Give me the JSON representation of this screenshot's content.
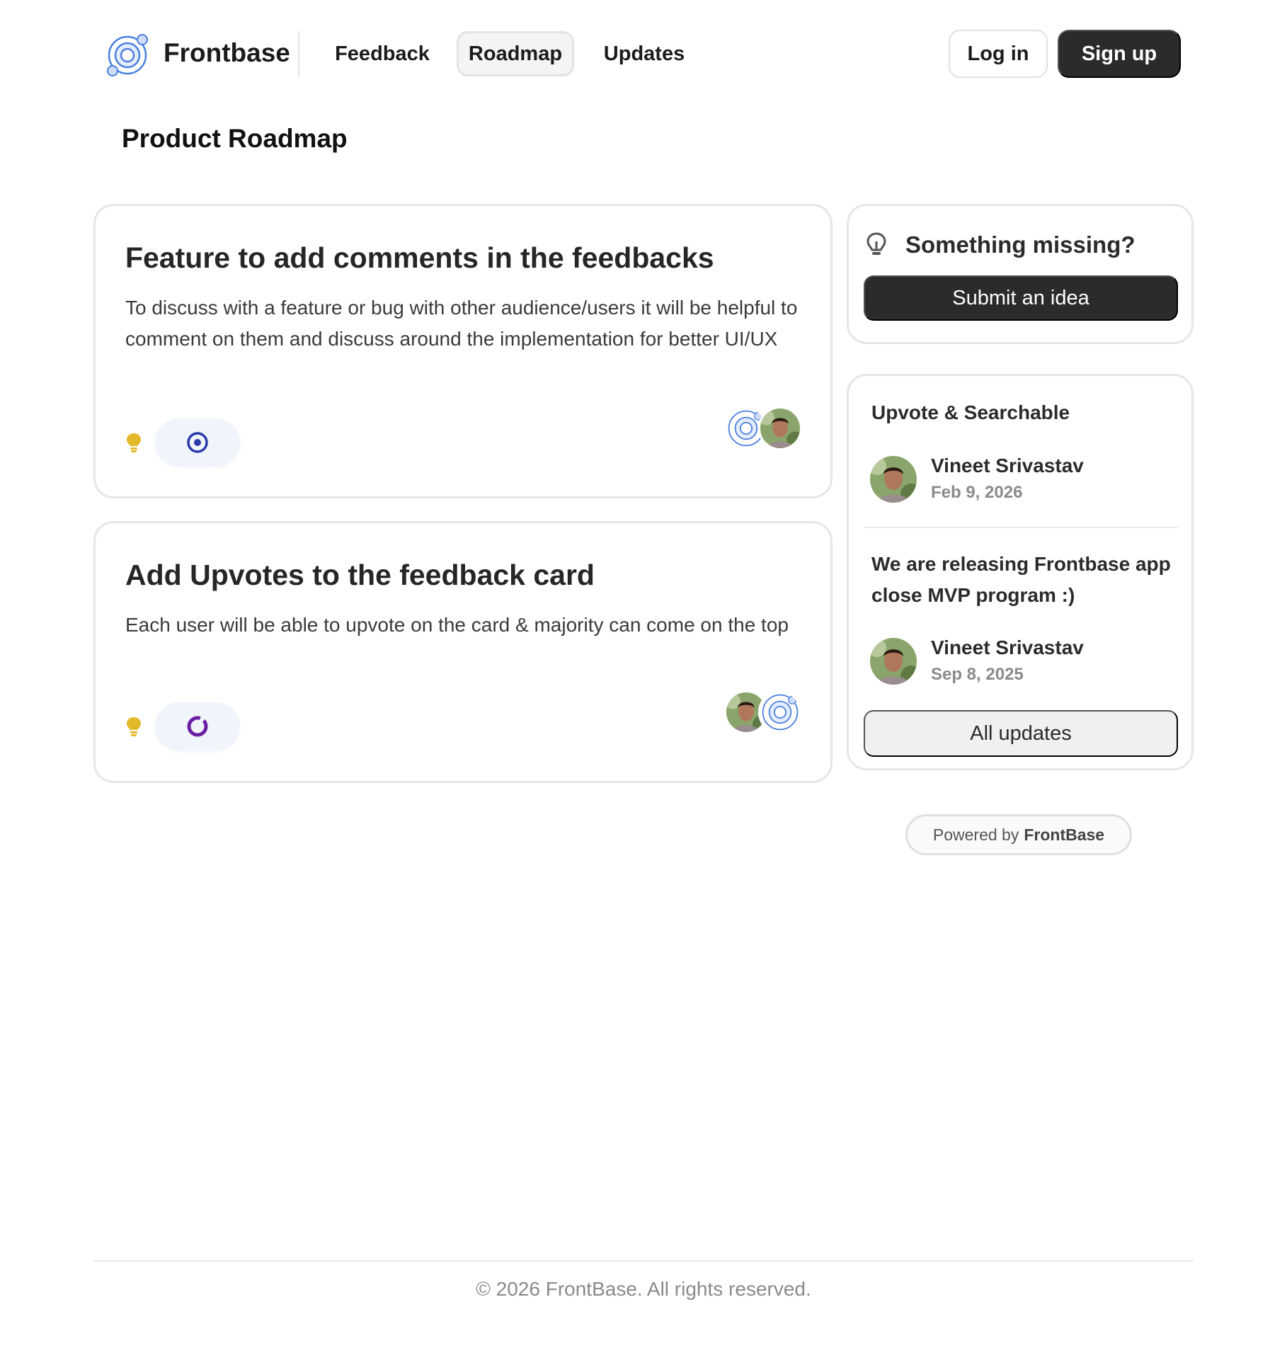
{
  "header": {
    "brand_name": "Frontbase",
    "nav": [
      {
        "label": "Feedback"
      },
      {
        "label": "Roadmap"
      },
      {
        "label": "Updates"
      }
    ],
    "login_label": "Log in",
    "signup_label": "Sign up"
  },
  "page_title": "Product Roadmap",
  "roadmap": [
    {
      "title": "Feature to add comments in the feedbacks",
      "description": "To discuss with a feature or bug with other audience/users it will be helpful to comment on them and discuss around the implementation for better UI/UX",
      "category_icon": "lightbulb-icon",
      "status_icon": "target-circle-icon",
      "status_color": "#2b3aa8"
    },
    {
      "title": "Add Upvotes to the feedback card",
      "description": "Each user will be able to upvote on the card & majority can come on the top",
      "category_icon": "lightbulb-icon",
      "status_icon": "in-progress-ring-icon",
      "status_color": "#6b1fa3"
    }
  ],
  "sidebar": {
    "missing_title": "Something missing?",
    "submit_label": "Submit an idea",
    "updates": [
      {
        "title": "Upvote & Searchable",
        "author": "Vineet Srivastav",
        "date": "Feb 9, 2026"
      },
      {
        "title": "We are releasing Frontbase app close MVP program :)",
        "author": "Vineet Srivastav",
        "date": "Sep 8, 2025"
      }
    ],
    "all_updates_label": "All updates"
  },
  "powered": {
    "prefix": "Powered by",
    "brand": "FrontBase"
  },
  "footer": {
    "text": "© 2026 FrontBase. All rights reserved."
  },
  "colors": {
    "accent_dark": "#2b2b2b",
    "logo_blue": "#4a7fe0",
    "bulb_yellow": "#e3b92a"
  }
}
